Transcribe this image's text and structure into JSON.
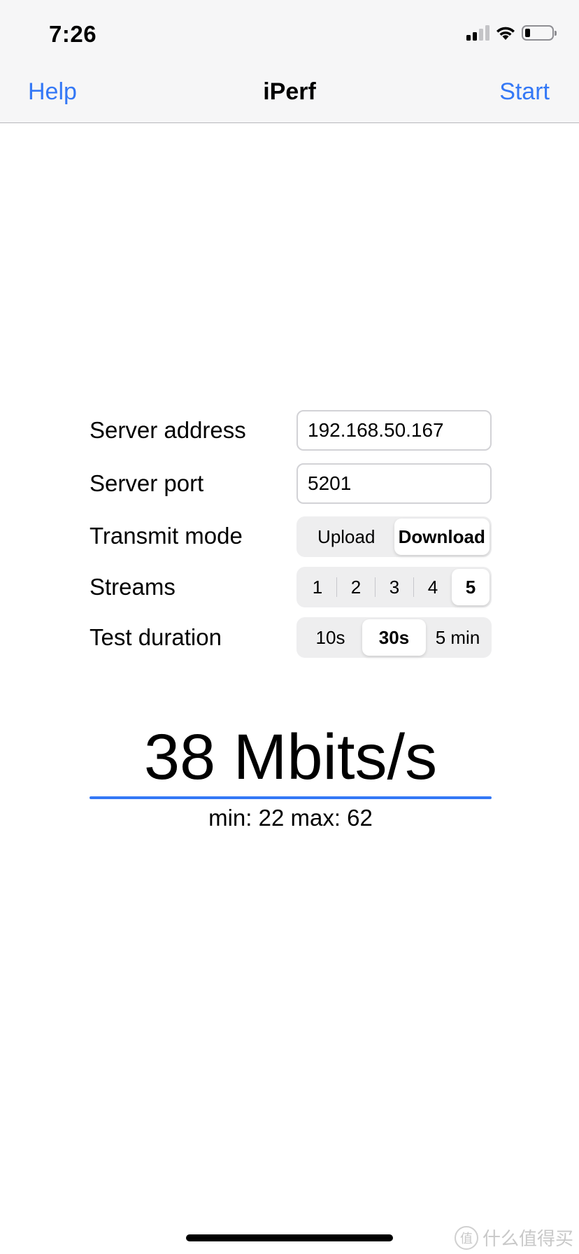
{
  "status_bar": {
    "time": "7:26",
    "icons": [
      "signal-icon",
      "wifi-icon",
      "battery-icon"
    ]
  },
  "nav": {
    "left_button": "Help",
    "title": "iPerf",
    "right_button": "Start"
  },
  "form": {
    "server_address": {
      "label": "Server address",
      "value": "192.168.50.167"
    },
    "server_port": {
      "label": "Server port",
      "value": "5201"
    },
    "transmit_mode": {
      "label": "Transmit mode",
      "options": [
        "Upload",
        "Download"
      ],
      "selected": "Download"
    },
    "streams": {
      "label": "Streams",
      "options": [
        "1",
        "2",
        "3",
        "4",
        "5"
      ],
      "selected": "5"
    },
    "test_duration": {
      "label": "Test duration",
      "options": [
        "10s",
        "30s",
        "5 min"
      ],
      "selected": "30s"
    }
  },
  "result": {
    "speed": "38 Mbits/s",
    "minmax": "min: 22 max: 62"
  },
  "colors": {
    "accent": "#3478f6",
    "nav_bg": "#f6f6f7",
    "segment_bg": "#eeeeef"
  },
  "watermark": {
    "badge": "值",
    "text": "什么值得买"
  }
}
